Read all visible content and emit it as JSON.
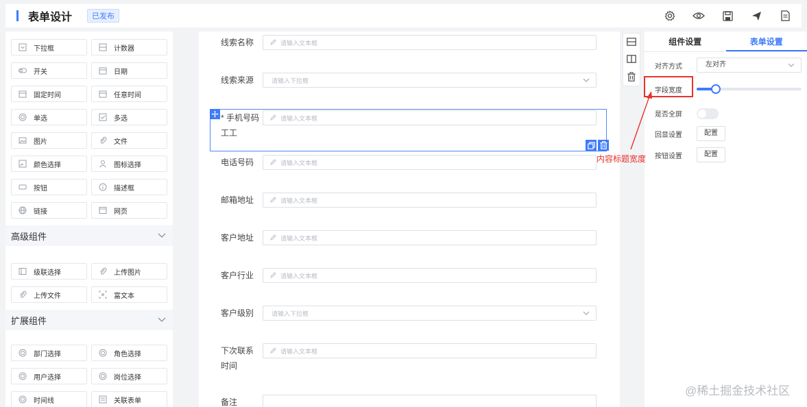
{
  "header": {
    "title": "表单设计",
    "badge": "已发布",
    "tools": [
      "gear-icon",
      "eye-icon",
      "save-icon",
      "send-icon",
      "document-icon"
    ]
  },
  "components": {
    "basic": [
      {
        "label": "下拉框",
        "icon": "select-icon"
      },
      {
        "label": "计数器",
        "icon": "counter-icon"
      },
      {
        "label": "开关",
        "icon": "switch-icon"
      },
      {
        "label": "日期",
        "icon": "calendar-icon"
      },
      {
        "label": "固定时间",
        "icon": "calendar-icon"
      },
      {
        "label": "任意时间",
        "icon": "calendar-icon"
      },
      {
        "label": "单选",
        "icon": "radio-icon"
      },
      {
        "label": "多选",
        "icon": "checkbox-icon"
      },
      {
        "label": "图片",
        "icon": "image-icon"
      },
      {
        "label": "文件",
        "icon": "paperclip-icon"
      },
      {
        "label": "颜色选择",
        "icon": "palette-icon"
      },
      {
        "label": "图标选择",
        "icon": "user-icon"
      },
      {
        "label": "按钮",
        "icon": "button-icon"
      },
      {
        "label": "描述框",
        "icon": "info-icon"
      },
      {
        "label": "链接",
        "icon": "globe-icon"
      },
      {
        "label": "网页",
        "icon": "browser-icon"
      }
    ],
    "advanced_title": "高级组件",
    "advanced": [
      {
        "label": "级联选择",
        "icon": "cascader-icon"
      },
      {
        "label": "上传图片",
        "icon": "paperclip-icon"
      },
      {
        "label": "上传文件",
        "icon": "paperclip-icon"
      },
      {
        "label": "富文本",
        "icon": "richtext-icon"
      }
    ],
    "extended_title": "扩展组件",
    "extended": [
      {
        "label": "部门选择",
        "icon": "radio-icon"
      },
      {
        "label": "角色选择",
        "icon": "radio-icon"
      },
      {
        "label": "用户选择",
        "icon": "radio-icon"
      },
      {
        "label": "岗位选择",
        "icon": "radio-icon"
      },
      {
        "label": "时间线",
        "icon": "radio-icon"
      },
      {
        "label": "关联表单",
        "icon": "form-icon"
      }
    ]
  },
  "form": {
    "fields": [
      {
        "label": "线索名称",
        "type": "input",
        "placeholder": "请输入文本框"
      },
      {
        "label": "线索来源",
        "type": "select",
        "placeholder": "请输入下拉框"
      },
      {
        "label": "* 手机号码",
        "label2": "工工",
        "type": "input",
        "placeholder": "请输入文本框"
      },
      {
        "label": "电话号码",
        "type": "input",
        "placeholder": "请输入文本框"
      },
      {
        "label": "邮箱地址",
        "type": "input",
        "placeholder": "请输入文本框"
      },
      {
        "label": "客户地址",
        "type": "input",
        "placeholder": "请输入文本框"
      },
      {
        "label": "客户行业",
        "type": "input",
        "placeholder": "请输入文本框"
      },
      {
        "label": "客户级别",
        "type": "select",
        "placeholder": "请输入下拉框"
      },
      {
        "label": "下次联系",
        "label2": "时间",
        "type": "input",
        "placeholder": "请输入文本框"
      },
      {
        "label": "备注",
        "type": "input",
        "placeholder": ""
      }
    ]
  },
  "right_panel": {
    "tabs": [
      "组件设置",
      "表单设置"
    ],
    "active_tab": 1,
    "align_label": "对齐方式",
    "align_value": "左对齐",
    "width_label": "字段宽度",
    "width_value": 0.18,
    "fullscreen_label": "是否全屏",
    "fullscreen_on": false,
    "echo_label": "回显设置",
    "echo_button": "配置",
    "button_label": "按钮设置",
    "button_button": "配置"
  },
  "annotation": {
    "text": "内容标题宽度"
  },
  "watermark": "@稀土掘金技术社区",
  "colors": {
    "accent": "#3e7bfa",
    "annotation": "#e8312b"
  }
}
